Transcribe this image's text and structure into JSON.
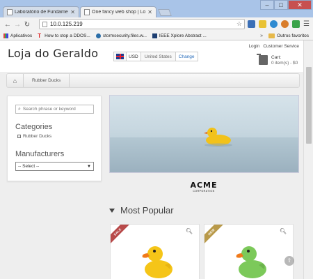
{
  "browser": {
    "tabs": [
      {
        "label": "Laboratório de Fundamen",
        "active": false
      },
      {
        "label": "One fancy web shop | Loja",
        "active": true
      }
    ],
    "url": "10.0.125.219",
    "bookmarks": [
      {
        "label": "Aplicativos",
        "icon": "apps-icon"
      },
      {
        "label": "How to stop a DDOS...",
        "icon": "bookmark-t-icon"
      },
      {
        "label": "stormsecurity.files.w...",
        "icon": "wordpress-icon"
      },
      {
        "label": "IEEE Xplore Abstract ...",
        "icon": "ieee-icon"
      }
    ],
    "bookmarks_more": "»",
    "bookmarks_folder": "Outros favoritos"
  },
  "header": {
    "logo": "Loja do Geraldo",
    "region": {
      "currency": "USD",
      "country": "United States",
      "change_label": "Change"
    },
    "links": [
      "Login",
      "Customer Service"
    ],
    "cart": {
      "title": "Cart:",
      "summary": "0 item(s) - $0"
    }
  },
  "breadcrumbs": {
    "home_icon": "home-icon",
    "items": [
      "Rubber Ducks"
    ]
  },
  "sidebar": {
    "search_placeholder": "Search phrase or keyword",
    "categories_title": "Categories",
    "categories": [
      "Rubber Ducks"
    ],
    "manufacturers_title": "Manufacturers",
    "manufacturer_select": "-- Select --"
  },
  "brand": {
    "name": "ACME",
    "sub": "CORPORATION"
  },
  "most_popular": {
    "title": "Most Popular",
    "products": [
      {
        "ribbon": "SALE",
        "ribbon_color": "#b84a4a",
        "duck_color": "#f5c518"
      },
      {
        "ribbon": "NEW",
        "ribbon_color": "#b99a4a",
        "duck_color": "#7cc95a"
      }
    ]
  },
  "colors": {
    "accent_link": "#2a6ebb",
    "duck_beak": "#f07a1a"
  }
}
